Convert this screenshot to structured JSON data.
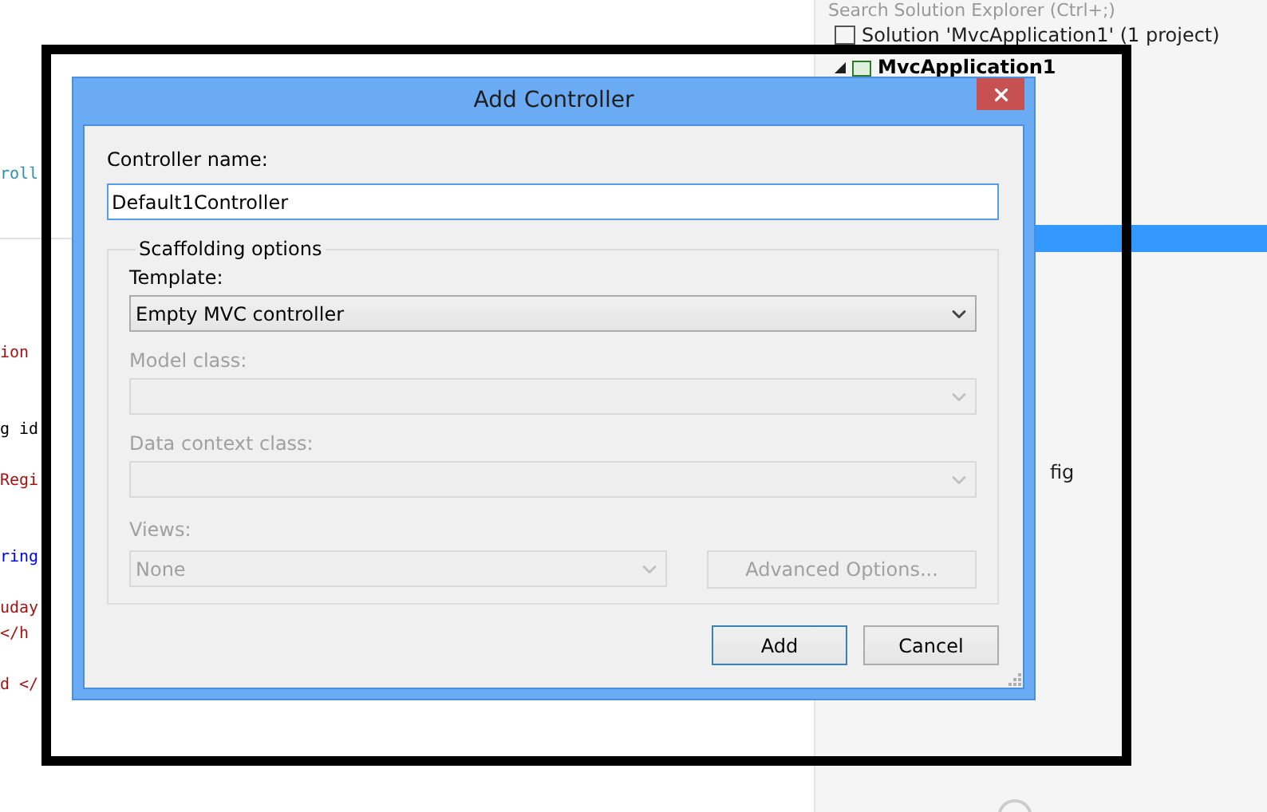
{
  "editor": {
    "fragments": [
      {
        "text": "roll",
        "kind": "type"
      },
      {
        "text": "ion",
        "kind": "string"
      },
      {
        "text": "g id",
        "kind": "plain"
      },
      {
        "text": "Regi",
        "kind": "string"
      },
      {
        "text": "ring",
        "kind": "keyword"
      },
      {
        "text": "uday",
        "kind": "string"
      },
      {
        "text": "</h",
        "kind": "string"
      },
      {
        "text": "d </",
        "kind": "string"
      }
    ]
  },
  "solution_explorer": {
    "search": {
      "placeholder": "Search Solution Explorer (Ctrl+;)"
    },
    "items": [
      {
        "label": "Solution 'MvcApplication1' (1 project)",
        "kind": "solution",
        "selected": false
      },
      {
        "label": "MvcApplication1",
        "kind": "project",
        "expanded": true,
        "selected": false
      },
      {
        "kind": "blank",
        "selected": true
      },
      {
        "label": "fig",
        "kind": "file",
        "selected": false
      }
    ]
  },
  "dialog": {
    "title": "Add Controller",
    "controller_name": {
      "label": "Controller name:",
      "value": "Default1Controller"
    },
    "scaffolding": {
      "legend": "Scaffolding options",
      "selects": [
        {
          "label": "Template:",
          "value": "Empty MVC controller",
          "disabled": false
        },
        {
          "label": "Model class:",
          "disabled": true
        },
        {
          "label": "Data context class:",
          "disabled": true
        }
      ],
      "views": {
        "label": "Views:",
        "value": "None",
        "disabled": true
      },
      "advanced_button": {
        "label": "Advanced Options...",
        "disabled": true
      }
    },
    "buttons": [
      {
        "label": "Add",
        "default": true
      },
      {
        "label": "Cancel",
        "default": false
      }
    ]
  }
}
